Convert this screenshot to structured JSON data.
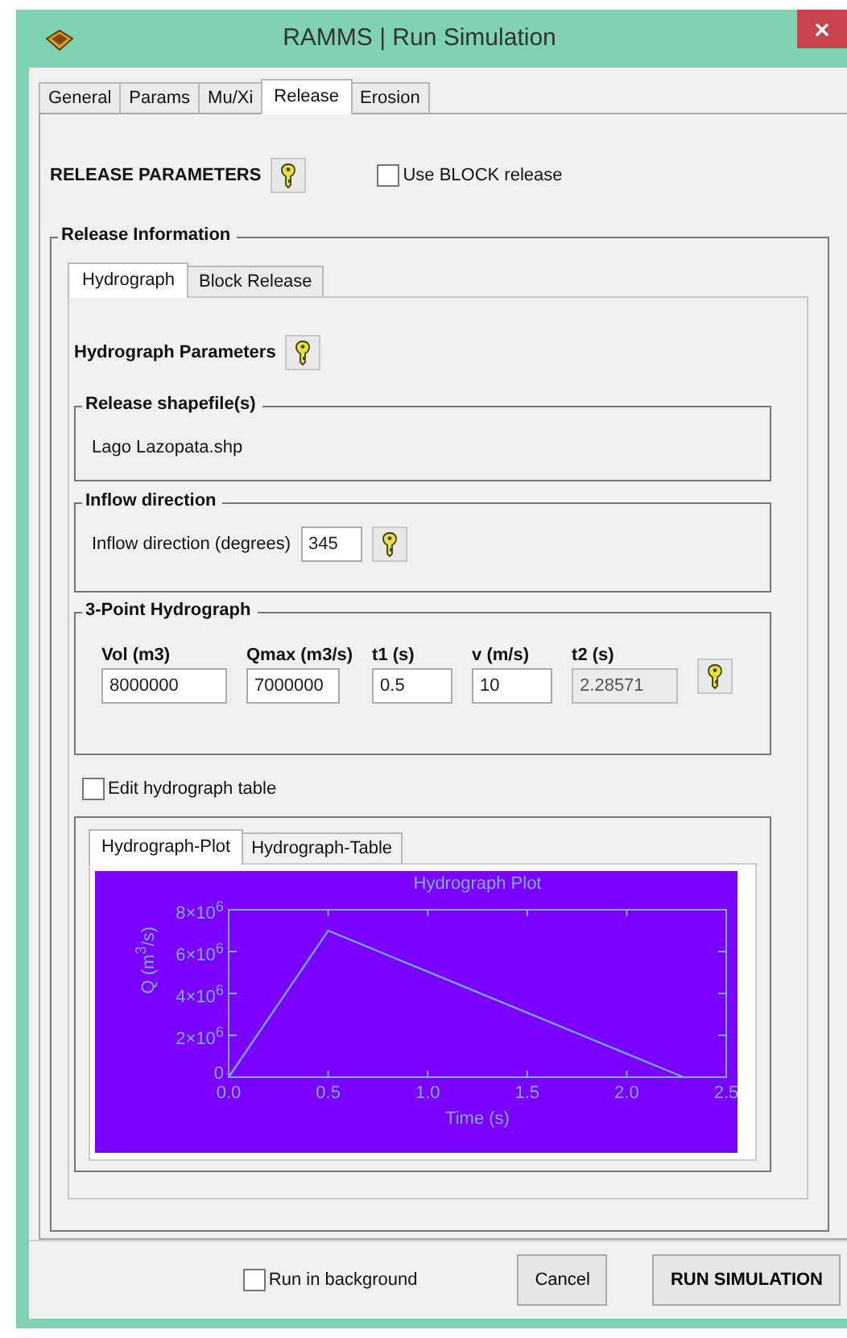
{
  "window": {
    "title": "RAMMS | Run Simulation"
  },
  "tabs": [
    {
      "label": "General",
      "selected": false
    },
    {
      "label": "Params",
      "selected": false
    },
    {
      "label": "Mu/Xi",
      "selected": false
    },
    {
      "label": "Release",
      "selected": true
    },
    {
      "label": "Erosion",
      "selected": false
    }
  ],
  "release_parameters": {
    "heading": "RELEASE PARAMETERS",
    "use_block_release": {
      "label": "Use BLOCK release",
      "checked": false
    }
  },
  "release_information": {
    "title": "Release Information",
    "tabs": [
      {
        "label": "Hydrograph",
        "selected": true
      },
      {
        "label": "Block Release",
        "selected": false
      }
    ],
    "hydrograph_heading": "Hydrograph Parameters",
    "shapefile_group": {
      "title": "Release shapefile(s)",
      "file": "Lago Lazopata.shp"
    },
    "inflow_group": {
      "title": "Inflow direction",
      "label": "Inflow direction (degrees)",
      "value": "345"
    },
    "three_point_group": {
      "title": "3-Point Hydrograph",
      "fields": [
        {
          "label": "Vol (m3)",
          "value": "8000000",
          "disabled": false
        },
        {
          "label": "Qmax (m3/s)",
          "value": "7000000",
          "disabled": false
        },
        {
          "label": "t1 (s)",
          "value": "0.5",
          "disabled": false
        },
        {
          "label": "v (m/s)",
          "value": "10",
          "disabled": false
        },
        {
          "label": "t2 (s)",
          "value": "2.28571",
          "disabled": true
        }
      ]
    },
    "edit_table": {
      "label": "Edit hydrograph table",
      "checked": false
    },
    "plot_tabs": [
      {
        "label": "Hydrograph-Plot",
        "selected": true
      },
      {
        "label": "Hydrograph-Table",
        "selected": false
      }
    ],
    "chart_data": {
      "type": "line",
      "title": "Hydrograph Plot",
      "xlabel": "Time  (s)",
      "ylabel": "Q (m$^{3}$/s)",
      "x": [
        0,
        0.5,
        2.28571
      ],
      "series": [
        {
          "color": "#6fa8ff",
          "values": [
            0,
            7000000,
            0
          ]
        }
      ],
      "xlim": [
        0,
        2.5
      ],
      "ylim": [
        0,
        8000000
      ],
      "xticks": [
        {
          "value": 0,
          "label": "0.0"
        },
        {
          "value": 0.5,
          "label": "0.5"
        },
        {
          "value": 1,
          "label": "1.0"
        },
        {
          "value": 1.5,
          "label": "1.5"
        },
        {
          "value": 2,
          "label": "2.0"
        },
        {
          "value": 2.5,
          "label": "2.5"
        }
      ],
      "yticks": [
        {
          "value": 0,
          "label": "0"
        },
        {
          "value": 2000000,
          "label": "2×10$^{6}$"
        },
        {
          "value": 4000000,
          "label": "4×10$^{6}$"
        },
        {
          "value": 6000000,
          "label": "6×10$^{6}$"
        },
        {
          "value": 8000000,
          "label": "8×10$^{6}$"
        }
      ]
    }
  },
  "footer": {
    "run_in_background": {
      "label": "Run in background",
      "checked": false
    },
    "buttons": [
      {
        "label": "Cancel",
        "kind": "normal"
      },
      {
        "label": "RUN SIMULATION",
        "kind": "primary"
      }
    ]
  }
}
